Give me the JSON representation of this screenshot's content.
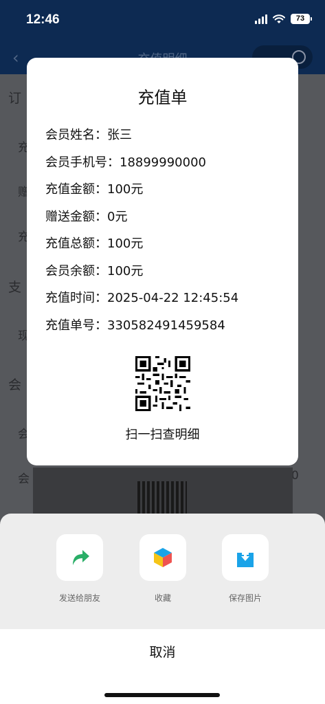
{
  "status_bar": {
    "time": "12:46",
    "battery": "73"
  },
  "background_page": {
    "nav_title": "充值明细",
    "section_labels": [
      "订",
      "支",
      "会"
    ],
    "row_labels": [
      "充",
      "赠",
      "充",
      "现",
      "会",
      "会"
    ],
    "trailing_value": "0"
  },
  "receipt": {
    "title": "充值单",
    "rows": [
      {
        "text": "会员姓名：张三"
      },
      {
        "text": "会员手机号：18899990000"
      },
      {
        "text": "充值金额：100元"
      },
      {
        "text": "赠送金额：0元"
      },
      {
        "text": "充值总额：100元"
      },
      {
        "text": "会员余额：100元"
      },
      {
        "text": "充值时间：2025-04-22 12:45:54"
      },
      {
        "text": "充值单号：330582491459584"
      }
    ],
    "qr_caption": "扫一扫查明细"
  },
  "share_sheet": {
    "actions": [
      {
        "label": "发送给朋友",
        "icon": "share-arrow-icon",
        "color": "#2aae67"
      },
      {
        "label": "收藏",
        "icon": "favorite-cube-icon",
        "color": "#f5a623"
      },
      {
        "label": "保存图片",
        "icon": "download-icon",
        "color": "#1aa3e8"
      }
    ],
    "cancel_label": "取消"
  }
}
